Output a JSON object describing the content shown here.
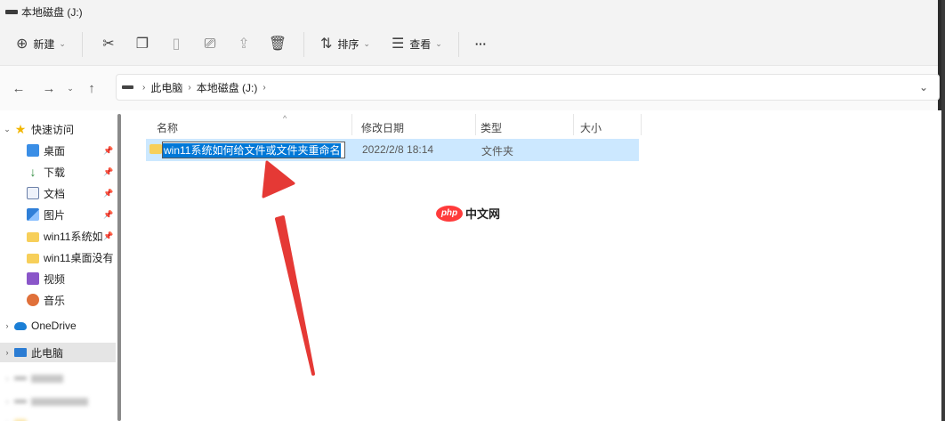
{
  "window": {
    "title": "本地磁盘 (J:)"
  },
  "toolbar": {
    "new_label": "新建",
    "sort_label": "排序",
    "view_label": "查看",
    "more_label": "···"
  },
  "address": {
    "segments": [
      "此电脑",
      "本地磁盘 (J:)"
    ]
  },
  "sidebar": {
    "quick_access": "快速访问",
    "items": [
      {
        "label": "桌面",
        "icon": "desktop-icon"
      },
      {
        "label": "下载",
        "icon": "download-icon"
      },
      {
        "label": "文档",
        "icon": "document-icon"
      },
      {
        "label": "图片",
        "icon": "pictures-icon"
      },
      {
        "label": "win11系统如",
        "icon": "folder-icon"
      },
      {
        "label": "win11桌面没有",
        "icon": "folder-icon"
      },
      {
        "label": "视频",
        "icon": "video-icon"
      },
      {
        "label": "音乐",
        "icon": "music-icon"
      }
    ],
    "onedrive": "OneDrive",
    "this_pc": "此电脑"
  },
  "columns": {
    "name": "名称",
    "modified": "修改日期",
    "type": "类型",
    "size": "大小"
  },
  "files": [
    {
      "name": "win11系统如何给文件或文件夹重命名",
      "modified": "2022/2/8 18:14",
      "type": "文件夹",
      "size": ""
    }
  ],
  "watermark": {
    "logo": "php",
    "text": "中文网"
  },
  "colors": {
    "selection": "#cce8ff",
    "text_highlight": "#0078d7",
    "arrow": "#e53935"
  }
}
